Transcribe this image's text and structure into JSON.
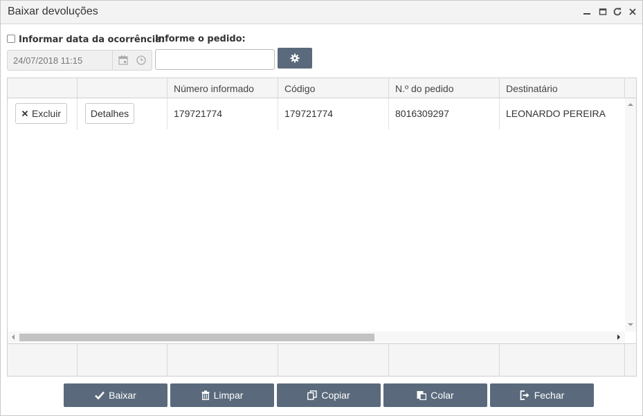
{
  "window": {
    "title": "Baixar devoluções",
    "controls": [
      "minimize-icon",
      "maximize-icon",
      "refresh-icon",
      "close-icon"
    ]
  },
  "form": {
    "date_checkbox_label": "Informar data da ocorrência:",
    "date_checked": false,
    "date_value": "24/07/2018 11:15",
    "order_label": "Informe o pedido:",
    "order_value": "",
    "gear_icon": "gear-icon"
  },
  "grid": {
    "columns": [
      "",
      "",
      "Número informado",
      "Código",
      "N.º do pedido",
      "Destinatário"
    ],
    "rows": [
      {
        "delete_label": "Excluir",
        "details_label": "Detalhes",
        "numero_informado": "179721774",
        "codigo": "179721774",
        "numero_pedido": "8016309297",
        "destinatario": "LEONARDO PEREIRA"
      }
    ]
  },
  "actions": {
    "baixar": "Baixar",
    "limpar": "Limpar",
    "copiar": "Copiar",
    "colar": "Colar",
    "fechar": "Fechar"
  },
  "colors": {
    "accent": "#5a6a7c",
    "titlebar": "#f3f3f3"
  }
}
